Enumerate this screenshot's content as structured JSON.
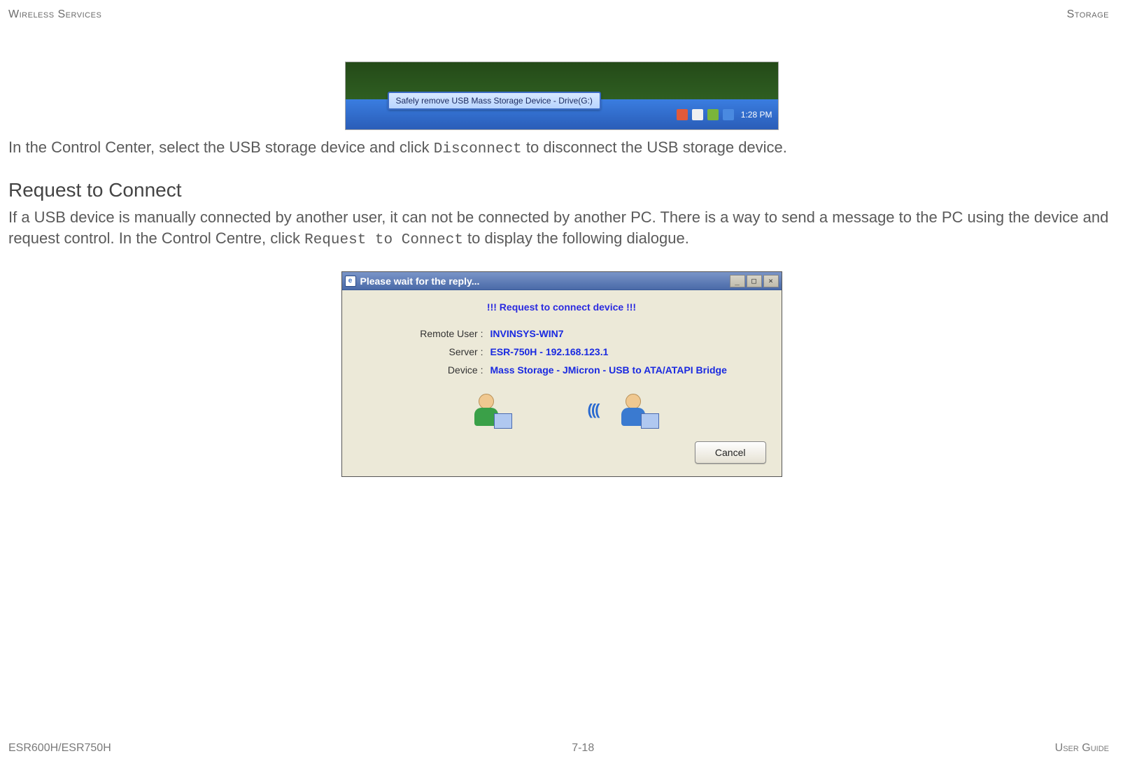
{
  "header": {
    "left": "Wireless Services",
    "right": "Storage"
  },
  "taskbar": {
    "tooltip": "Safely remove USB Mass Storage Device - Drive(G:)",
    "time": "1:28 PM"
  },
  "paragraph1": {
    "pre": "In the Control Center, select the USB storage device and click ",
    "code": "Disconnect",
    "post": " to disconnect the USB storage device."
  },
  "section_heading": "Request to Connect",
  "paragraph2": {
    "pre": "If a USB device is manually connected by another user, it can not be connected by another PC. There is a way to send a message to the PC using the device and request control. In the Control Centre, click ",
    "code": "Request to Connect",
    "post": " to display the following dialogue."
  },
  "dialog": {
    "title": "Please wait for the reply...",
    "banner": "!!! Request to connect device !!!",
    "rows": {
      "remote_user": {
        "label": "Remote User :",
        "value": "INVINSYS-WIN7"
      },
      "server": {
        "label": "Server :",
        "value": "ESR-750H - 192.168.123.1"
      },
      "device": {
        "label": "Device :",
        "value": "Mass Storage - JMicron - USB to ATA/ATAPI Bridge"
      }
    },
    "buttons": {
      "cancel": "Cancel",
      "minimize": "_",
      "maximize": "□",
      "close": "×"
    },
    "waves": "((("
  },
  "footer": {
    "left": "ESR600H/ESR750H",
    "center": "7-18",
    "right": "User Guide"
  }
}
